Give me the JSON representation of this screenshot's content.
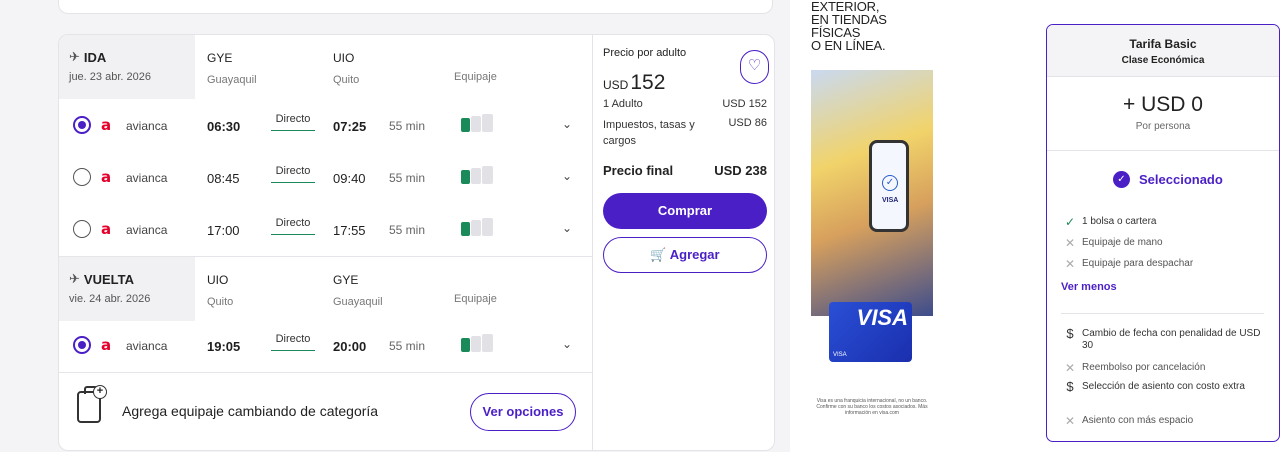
{
  "outbound": {
    "title": "IDA",
    "date": "jue. 23 abr. 2026",
    "origin_code": "GYE",
    "origin_city": "Guayaquil",
    "dest_code": "UIO",
    "dest_city": "Quito",
    "luggage_header": "Equipaje",
    "flights": [
      {
        "airline": "avianca",
        "dep": "06:30",
        "stops": "Directo",
        "arr": "07:25",
        "duration": "55 min",
        "selected": true
      },
      {
        "airline": "avianca",
        "dep": "08:45",
        "stops": "Directo",
        "arr": "09:40",
        "duration": "55 min",
        "selected": false
      },
      {
        "airline": "avianca",
        "dep": "17:00",
        "stops": "Directo",
        "arr": "17:55",
        "duration": "55 min",
        "selected": false
      }
    ]
  },
  "return": {
    "title": "VUELTA",
    "date": "vie. 24 abr. 2026",
    "origin_code": "UIO",
    "origin_city": "Quito",
    "dest_code": "GYE",
    "dest_city": "Guayaquil",
    "luggage_header": "Equipaje",
    "flights": [
      {
        "airline": "avianca",
        "dep": "19:05",
        "stops": "Directo",
        "arr": "20:00",
        "duration": "55 min",
        "selected": true
      }
    ]
  },
  "airline_logo_text": "a",
  "footer": {
    "text": "Agrega equipaje cambiando de categoría",
    "button": "Ver opciones"
  },
  "price": {
    "label": "Precio por adulto",
    "currency": "USD",
    "amount": "152",
    "lines": [
      {
        "label": "1 Adulto",
        "value": "USD 152"
      },
      {
        "label": "Impuestos, tasas y cargos",
        "value": "USD 86"
      }
    ],
    "final_label": "Precio final",
    "final_value": "USD 238",
    "buy_button": "Comprar",
    "add_button": "Agregar"
  },
  "ad": {
    "headline": "EXTERIOR,\nEN TIENDAS FÍSICAS\nO EN LÍNEA.",
    "phone_brand": "VISA",
    "card_logo": "VISA",
    "card_small": "VISA",
    "fine_print": "Visa es una franquicia internacional, no un banco. Confirme con su banco los costos asociados. Más información en visa.com"
  },
  "fare": {
    "title": "Tarifa Basic",
    "subtitle": "Clase Económica",
    "price": "+ USD 0",
    "per": "Por persona",
    "selected_label": "Seleccionado",
    "features": [
      {
        "icon": "check",
        "text": "1 bolsa o cartera"
      },
      {
        "icon": "cross",
        "text": "Equipaje de mano"
      },
      {
        "icon": "cross",
        "text": "Equipaje para despachar"
      }
    ],
    "toggle": "Ver menos",
    "conditions": [
      {
        "icon": "dollar",
        "text": "Cambio de fecha con penalidad de USD 30"
      },
      {
        "icon": "cross",
        "text": "Reembolso por cancelación"
      },
      {
        "icon": "dollar",
        "text": "Selección de asiento con costo extra"
      },
      {
        "icon": "cross",
        "text": "Asiento con más espacio"
      }
    ]
  },
  "colors": {
    "accent": "#4b1fc6",
    "brand_airline": "#e4002b",
    "bag_included": "#1a8a5a"
  }
}
